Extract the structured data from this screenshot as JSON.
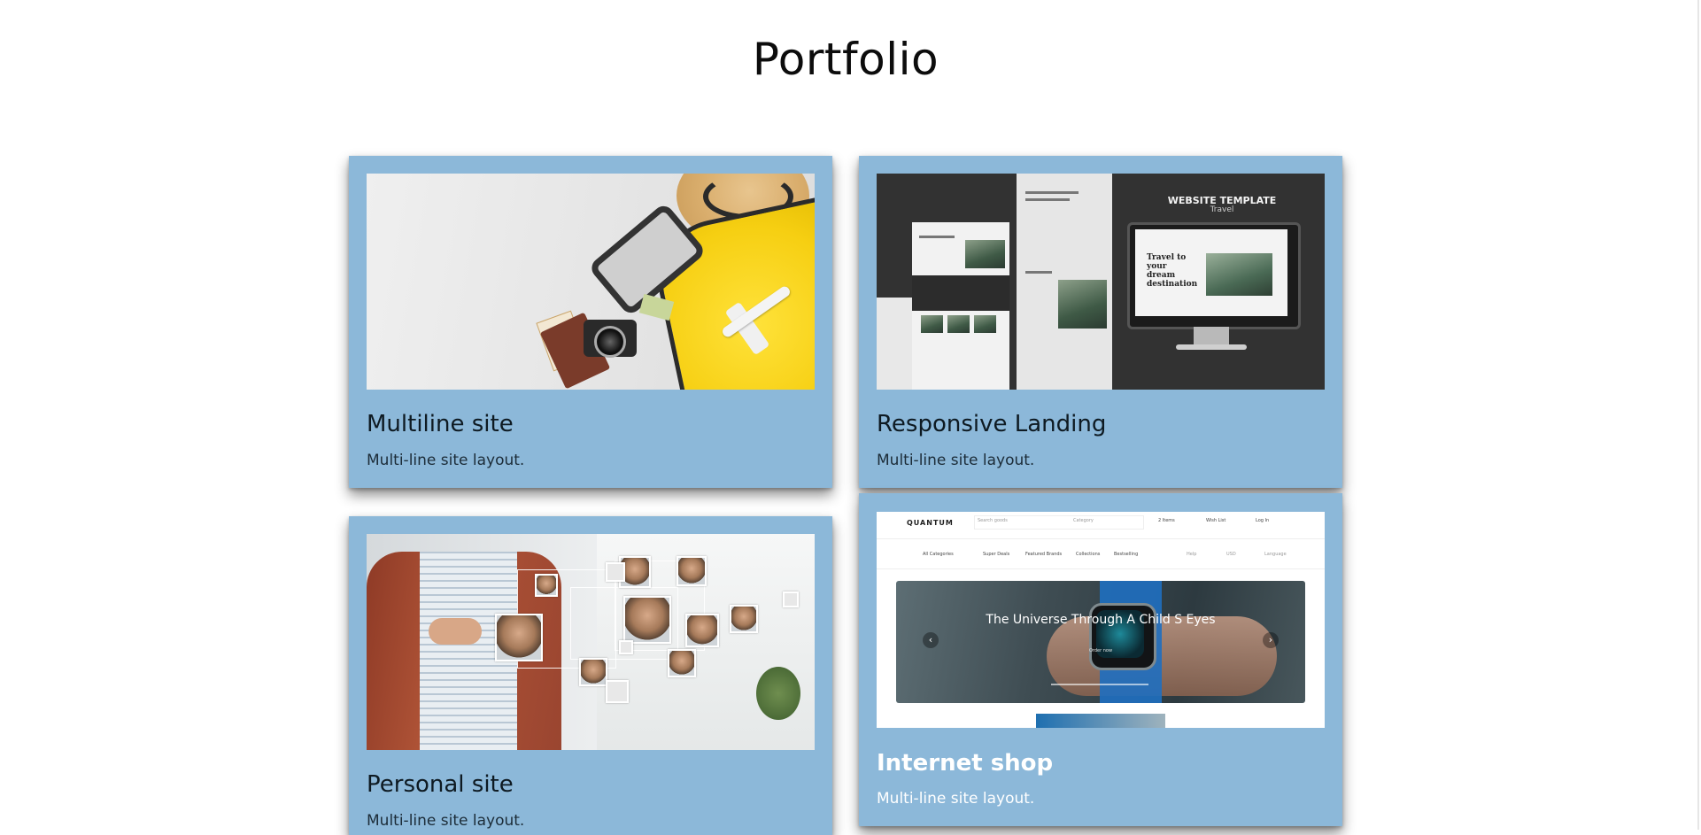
{
  "page": {
    "title": "Portfolio"
  },
  "colors": {
    "card_background": "#8cb8d9",
    "card_title": "#0e1a22",
    "card_highlight_title": "#ffffff"
  },
  "cards": [
    {
      "title": "Multiline site",
      "description": "Multi-line site layout.",
      "image": "travel-suitcase-photo"
    },
    {
      "title": "Responsive Landing",
      "description": "Multi-line site layout.",
      "image": "website-template-mockup",
      "image_text": {
        "heading": "WEBSITE TEMPLATE",
        "subheading": "Travel",
        "monitor_headline": "Travel to your dream destination"
      }
    },
    {
      "title": "Personal site",
      "description": "Multi-line site layout.",
      "image": "business-network-photo"
    },
    {
      "title": "Internet shop",
      "description": "Multi-line site layout.",
      "image": "online-shop-screenshot",
      "image_text": {
        "brand": "QUANTUM",
        "search_placeholder": "Search goods",
        "category": "Category",
        "cart": "2 Items",
        "wishlist": "Wish List",
        "login": "Log In",
        "all_categories": "All Categories",
        "nav": [
          "Super Deals",
          "Featured Brands",
          "Collections",
          "Bestselling"
        ],
        "help": "Help",
        "currency": "USD",
        "language": "Language",
        "hero_text": "The Universe Through A Child S Eyes",
        "hero_button": "Order now"
      }
    }
  ]
}
